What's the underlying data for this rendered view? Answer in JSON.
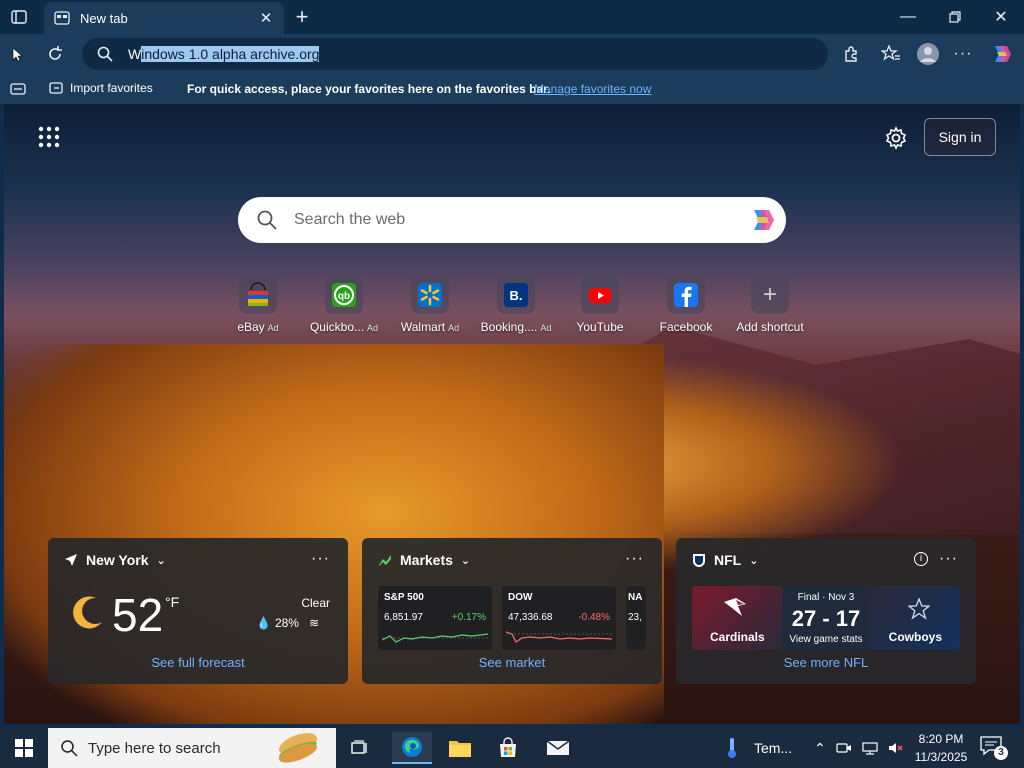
{
  "browser": {
    "tab_title": "New tab",
    "address_prefix": "W",
    "address_selected": "indows 1.0 alpha archive.org",
    "favbar": {
      "import_label": "Import favorites",
      "message": "For quick access, place your favorites here on the favorites bar.",
      "manage_link": "Manage favorites now"
    }
  },
  "newtab": {
    "signin_label": "Sign in",
    "search_placeholder": "Search the web",
    "shortcuts": [
      {
        "label": "eBay",
        "ad": "Ad",
        "icon": "ebay-icon"
      },
      {
        "label": "Quickbo...",
        "ad": "Ad",
        "icon": "quickbooks-icon"
      },
      {
        "label": "Walmart",
        "ad": "Ad",
        "icon": "walmart-icon"
      },
      {
        "label": "Booking....",
        "ad": "Ad",
        "icon": "booking-icon"
      },
      {
        "label": "YouTube",
        "ad": "",
        "icon": "youtube-icon"
      },
      {
        "label": "Facebook",
        "ad": "",
        "icon": "facebook-icon"
      },
      {
        "label": "Add shortcut",
        "ad": "",
        "icon": "plus-icon"
      }
    ],
    "weather": {
      "location": "New York",
      "temp": "52",
      "unit": "°F",
      "condition": "Clear",
      "precip": "28%",
      "link": "See full forecast"
    },
    "markets": {
      "title": "Markets",
      "stocks": [
        {
          "name": "S&P 500",
          "value": "6,851.97",
          "change": "+0.17%",
          "color": "#5fd16b"
        },
        {
          "name": "DOW",
          "value": "47,336.68",
          "change": "-0.48%",
          "color": "#ff6b6b"
        },
        {
          "name": "NA",
          "value": "23,",
          "change": "",
          "color": "#5fd16b"
        }
      ],
      "link": "See market"
    },
    "nfl": {
      "title": "NFL",
      "home": "Cardinals",
      "away": "Cowboys",
      "status": "Final · Nov 3",
      "score": "27 - 17",
      "stats": "View game stats",
      "link": "See more NFL"
    }
  },
  "taskbar": {
    "search_placeholder": "Type here to search",
    "weather_label": "Tem...",
    "time": "8:20 PM",
    "date": "11/3/2025",
    "notif_count": "3"
  }
}
